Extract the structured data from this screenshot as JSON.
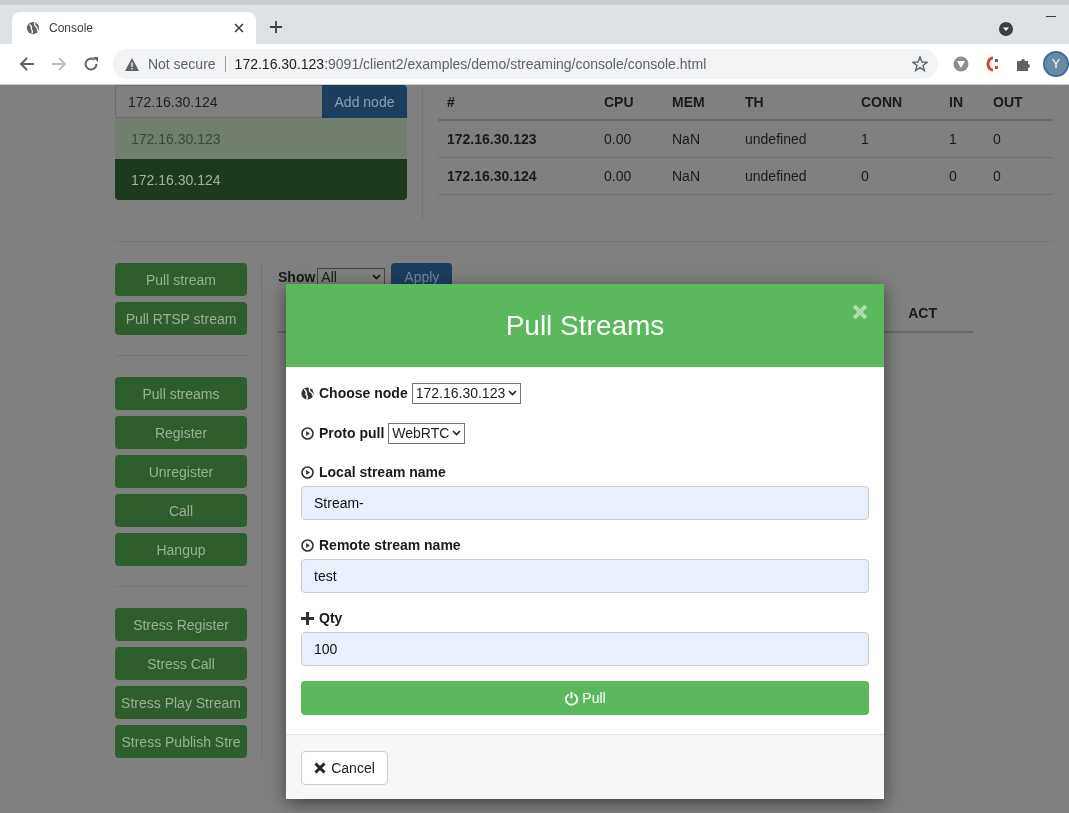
{
  "browser": {
    "tab_title": "Console",
    "security": "Not secure",
    "url_host": "172.16.30.123",
    "url_path": ":9091/client2/examples/demo/streaming/console/console.html",
    "profile": "Y"
  },
  "nodes": {
    "input": "172.16.30.124",
    "add_button": "Add node",
    "items": [
      {
        "label": "172.16.30.123",
        "selected": false
      },
      {
        "label": "172.16.30.124",
        "selected": true
      }
    ]
  },
  "node_table": {
    "columns": [
      "#",
      "CPU",
      "MEM",
      "TH",
      "CONN",
      "IN",
      "OUT"
    ],
    "rows": [
      [
        "172.16.30.123",
        "0.00",
        "NaN",
        "undefined",
        "1",
        "1",
        "0"
      ],
      [
        "172.16.30.124",
        "0.00",
        "NaN",
        "undefined",
        "0",
        "0",
        "0"
      ]
    ]
  },
  "button_groups": [
    [
      "Pull stream",
      "Pull RTSP stream"
    ],
    [
      "Pull streams",
      "Register",
      "Unregister",
      "Call",
      "Hangup"
    ],
    [
      "Stress Register",
      "Stress Call",
      "Stress Play Stream",
      "Stress Publish Stre"
    ]
  ],
  "filter": {
    "label": "Show",
    "value": "All",
    "apply": "Apply"
  },
  "streams_table": {
    "columns": [
      "ACT"
    ]
  },
  "modal": {
    "title": "Pull Streams",
    "fields": [
      {
        "kind": "select",
        "label": "Choose node",
        "value": "172.16.30.123"
      },
      {
        "kind": "select",
        "label": "Proto pull",
        "value": "WebRTC"
      },
      {
        "kind": "input",
        "label": "Local stream name",
        "value": "Stream-"
      },
      {
        "kind": "input",
        "label": "Remote stream name",
        "value": "test"
      },
      {
        "kind": "input",
        "label": "Qty",
        "value": "100"
      }
    ],
    "submit": "Pull",
    "cancel": "Cancel"
  }
}
